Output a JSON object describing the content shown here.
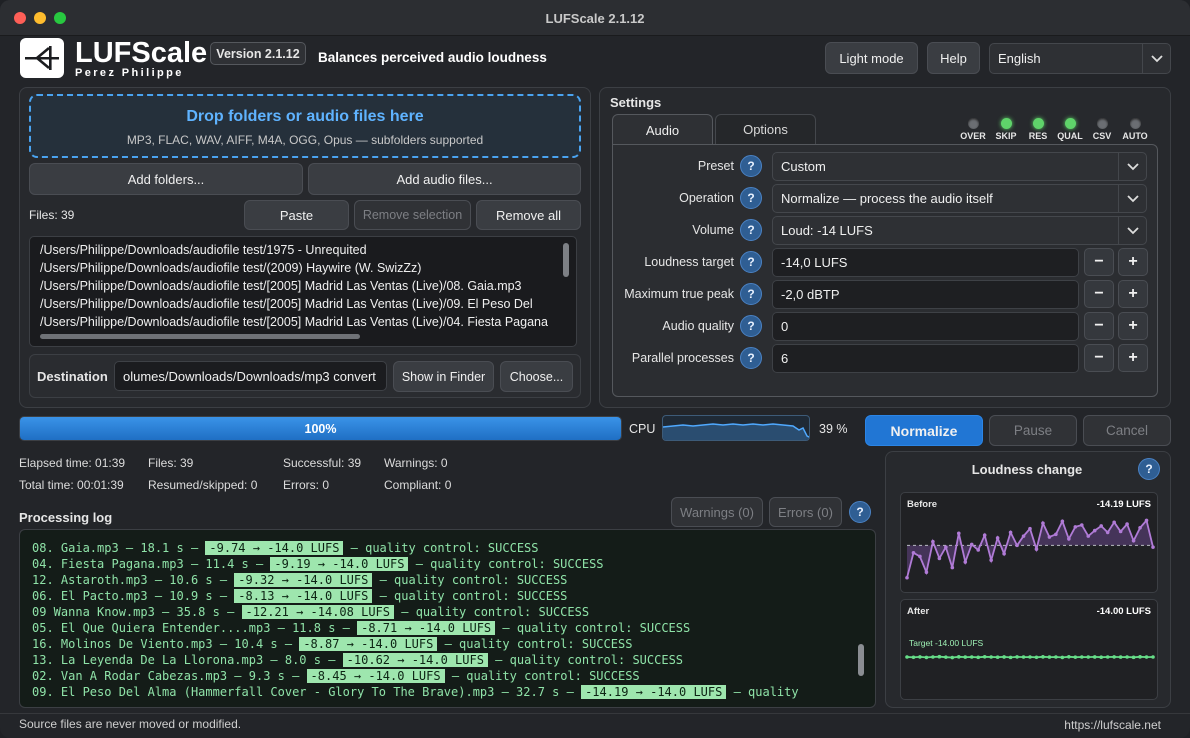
{
  "window": {
    "title": "LUFScale 2.1.12"
  },
  "header": {
    "app_name": "LUFScale",
    "author": "Perez Philippe",
    "version": "Version 2.1.12",
    "tagline": "Balances perceived audio loudness",
    "light_mode": "Light mode",
    "help": "Help",
    "language": "English"
  },
  "files": {
    "drop_title": "Drop folders or audio files here",
    "drop_subtitle": "MP3, FLAC, WAV, AIFF, M4A, OGG, Opus — subfolders supported",
    "add_folders": "Add folders...",
    "add_files": "Add audio files...",
    "count": "Files: 39",
    "paste": "Paste",
    "remove_selection": "Remove selection",
    "remove_all": "Remove all",
    "list": [
      "/Users/Philippe/Downloads/audiofile test/1975 - Unrequited",
      "/Users/Philippe/Downloads/audiofile test/(2009) Haywire (W. SwizZz)",
      "/Users/Philippe/Downloads/audiofile test/[2005] Madrid Las Ventas (Live)/08. Gaia.mp3",
      "/Users/Philippe/Downloads/audiofile test/[2005] Madrid Las Ventas (Live)/09. El Peso Del",
      "/Users/Philippe/Downloads/audiofile test/[2005] Madrid Las Ventas (Live)/04. Fiesta Pagana"
    ],
    "destination_label": "Destination",
    "destination_value": "olumes/Downloads/Downloads/mp3 convert",
    "show_in_finder": "Show in Finder",
    "choose": "Choose..."
  },
  "settings": {
    "title": "Settings",
    "tabs": [
      "Audio",
      "Options"
    ],
    "leds": [
      {
        "label": "OVER",
        "color": "#6b6e73"
      },
      {
        "label": "SKIP",
        "color": "#5fd36a"
      },
      {
        "label": "RES",
        "color": "#5fd36a"
      },
      {
        "label": "QUAL",
        "color": "#5fd36a"
      },
      {
        "label": "CSV",
        "color": "#6b6e73"
      },
      {
        "label": "AUTO",
        "color": "#6b6e73"
      }
    ],
    "preset_label": "Preset",
    "preset_value": "Custom",
    "operation_label": "Operation",
    "operation_value": "Normalize — process the audio itself",
    "volume_label": "Volume",
    "volume_value": "Loud: -14 LUFS",
    "loudness_label": "Loudness target",
    "loudness_value": "-14,0 LUFS",
    "peak_label": "Maximum true peak",
    "peak_value": "-2,0 dBTP",
    "quality_label": "Audio quality",
    "quality_value": "0",
    "parallel_label": "Parallel processes",
    "parallel_value": "6",
    "help_glyph": "?",
    "minus": "−",
    "plus": "+"
  },
  "progress": {
    "percent": 100,
    "text": "100%",
    "cpu_label": "CPU",
    "cpu_value": "39 %",
    "normalize": "Normalize",
    "pause": "Pause",
    "cancel": "Cancel"
  },
  "stats": {
    "elapsed": "Elapsed time: 01:39",
    "total": "Total time: 00:01:39",
    "files": "Files: 39",
    "resumed": "Resumed/skipped: 0",
    "successful": "Successful: 39",
    "errors": "Errors: 0",
    "warnings": "Warnings: 0",
    "compliant": "Compliant: 0"
  },
  "log": {
    "title": "Processing log",
    "warnings_btn": "Warnings (0)",
    "errors_btn": "Errors (0)",
    "lines": [
      {
        "pre": "08. Gaia.mp3 — 18.1 s — ",
        "hl": "-9.74 → -14.0 LUFS",
        "post": " — quality control: SUCCESS"
      },
      {
        "pre": "04. Fiesta Pagana.mp3 — 11.4 s — ",
        "hl": "-9.19 → -14.0 LUFS",
        "post": " — quality control: SUCCESS"
      },
      {
        "pre": "12. Astaroth.mp3 — 10.6 s — ",
        "hl": "-9.32 → -14.0 LUFS",
        "post": " — quality control: SUCCESS"
      },
      {
        "pre": "06. El Pacto.mp3 — 10.9 s — ",
        "hl": "-8.13 → -14.0 LUFS",
        "post": " — quality control: SUCCESS"
      },
      {
        "pre": "09 Wanna Know.mp3 — 35.8 s — ",
        "hl": "-12.21 → -14.08 LUFS",
        "post": " — quality control: SUCCESS"
      },
      {
        "pre": "05. El Que Quiera Entender....mp3 — 11.8 s — ",
        "hl": "-8.71 → -14.0 LUFS",
        "post": " — quality control: SUCCESS"
      },
      {
        "pre": "16. Molinos De Viento.mp3 — 10.4 s — ",
        "hl": "-8.87 → -14.0 LUFS",
        "post": " — quality control: SUCCESS"
      },
      {
        "pre": "13. La Leyenda De La Llorona.mp3 — 8.0 s — ",
        "hl": "-10.62 → -14.0 LUFS",
        "post": " — quality control: SUCCESS"
      },
      {
        "pre": "02. Van A Rodar Cabezas.mp3 — 9.3 s — ",
        "hl": "-8.45 → -14.0 LUFS",
        "post": " — quality control: SUCCESS"
      },
      {
        "pre": "09. El Peso Del Alma (Hammerfall Cover - Glory To The Brave).mp3 — 32.7 s — ",
        "hl": "-14.19 → -14.0 LUFS",
        "post": " — quality"
      }
    ]
  },
  "loudness": {
    "title": "Loudness change",
    "before_label": "Before",
    "before_value": "-14.19 LUFS",
    "after_label": "After",
    "after_value": "-14.00 LUFS",
    "target_label": "Target -14.00 LUFS"
  },
  "chart_data": {
    "type": "line",
    "target": -14.0,
    "before": [
      -17.5,
      -14.8,
      -15.2,
      -16.9,
      -13.6,
      -15.4,
      -14.2,
      -16.4,
      -12.7,
      -15.8,
      -13.9,
      -14.5,
      -12.9,
      -15.6,
      -13.2,
      -14.9,
      -12.6,
      -14.0,
      -13.0,
      -12.2,
      -14.4,
      -11.6,
      -13.1,
      -12.8,
      -11.4,
      -13.3,
      -12.0,
      -11.8,
      -13.0,
      -12.4,
      -11.9,
      -12.6,
      -11.5,
      -12.5,
      -11.7,
      -13.5,
      -12.1,
      -11.3,
      -14.19
    ],
    "after": [
      -14.0,
      -14.05,
      -13.98,
      -14.08,
      -14.0,
      -13.95,
      -14.03,
      -14.1,
      -13.97,
      -14.02,
      -14.0,
      -14.06,
      -13.96,
      -14.0,
      -14.04,
      -13.99,
      -14.07,
      -13.98,
      -14.01,
      -14.0,
      -14.05,
      -13.97,
      -14.02,
      -14.0,
      -14.08,
      -13.96,
      -14.03,
      -14.0,
      -14.01,
      -13.99,
      -14.04,
      -14.0,
      -13.98,
      -14.02,
      -14.0,
      -14.06,
      -13.97,
      -14.01,
      -14.0
    ]
  },
  "footer": {
    "left": "Source files are never moved or modified.",
    "right": "https://lufscale.net"
  }
}
